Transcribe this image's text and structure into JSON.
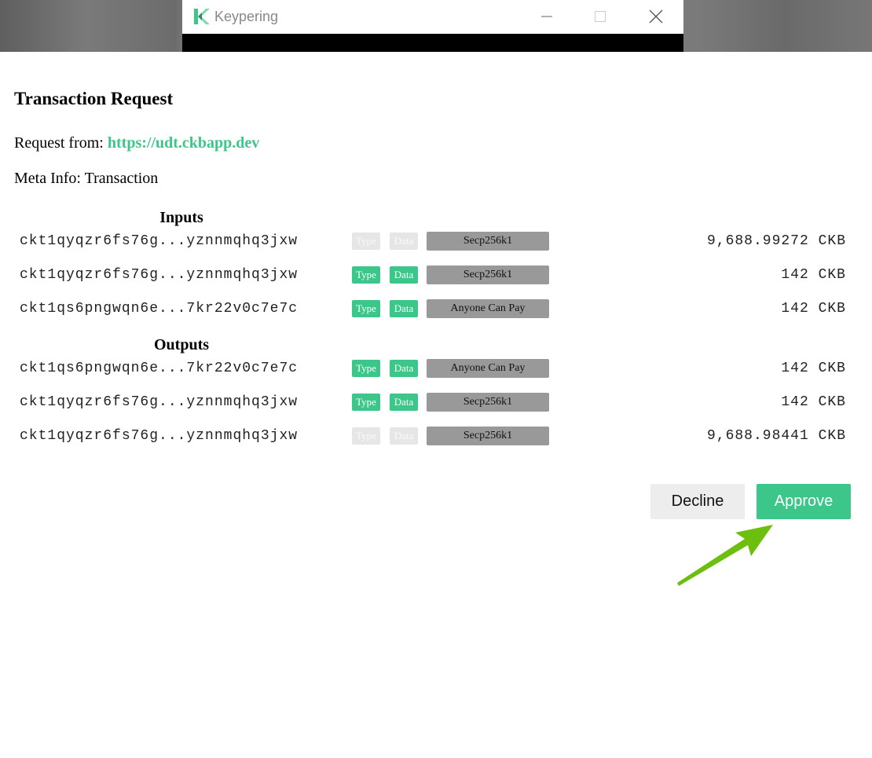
{
  "window": {
    "app_title": "Keypering",
    "controls": [
      "minimize",
      "maximize",
      "close"
    ]
  },
  "page": {
    "title": "Transaction Request",
    "request_from_label": "Request from:",
    "request_from_url": "https://udt.ckbapp.dev",
    "meta_info": "Meta Info: Transaction"
  },
  "inputs": {
    "heading": "Inputs",
    "rows": [
      {
        "address": "ckt1qyqzr6fs76g...yznnmqhq3jxw",
        "type": "Type",
        "data": "Data",
        "type_active": false,
        "data_active": false,
        "lock": "Secp256k1",
        "amount": "9,688.99272 CKB"
      },
      {
        "address": "ckt1qyqzr6fs76g...yznnmqhq3jxw",
        "type": "Type",
        "data": "Data",
        "type_active": true,
        "data_active": true,
        "lock": "Secp256k1",
        "amount": "142 CKB"
      },
      {
        "address": "ckt1qs6pngwqn6e...7kr22v0c7e7c",
        "type": "Type",
        "data": "Data",
        "type_active": true,
        "data_active": true,
        "lock": "Anyone Can Pay",
        "amount": "142 CKB"
      }
    ]
  },
  "outputs": {
    "heading": "Outputs",
    "rows": [
      {
        "address": "ckt1qs6pngwqn6e...7kr22v0c7e7c",
        "type": "Type",
        "data": "Data",
        "type_active": true,
        "data_active": true,
        "lock": "Anyone Can Pay",
        "amount": "142 CKB"
      },
      {
        "address": "ckt1qyqzr6fs76g...yznnmqhq3jxw",
        "type": "Type",
        "data": "Data",
        "type_active": true,
        "data_active": true,
        "lock": "Secp256k1",
        "amount": "142 CKB"
      },
      {
        "address": "ckt1qyqzr6fs76g...yznnmqhq3jxw",
        "type": "Type",
        "data": "Data",
        "type_active": false,
        "data_active": false,
        "lock": "Secp256k1",
        "amount": "9,688.98441 CKB"
      }
    ]
  },
  "actions": {
    "decline_label": "Decline",
    "approve_label": "Approve"
  },
  "colors": {
    "accent": "#3cc68a",
    "tag_inactive": "#e6e6e6",
    "lock_bg": "#999999",
    "decline_bg": "#ededed",
    "pointer_arrow": "#6cbf0f"
  }
}
